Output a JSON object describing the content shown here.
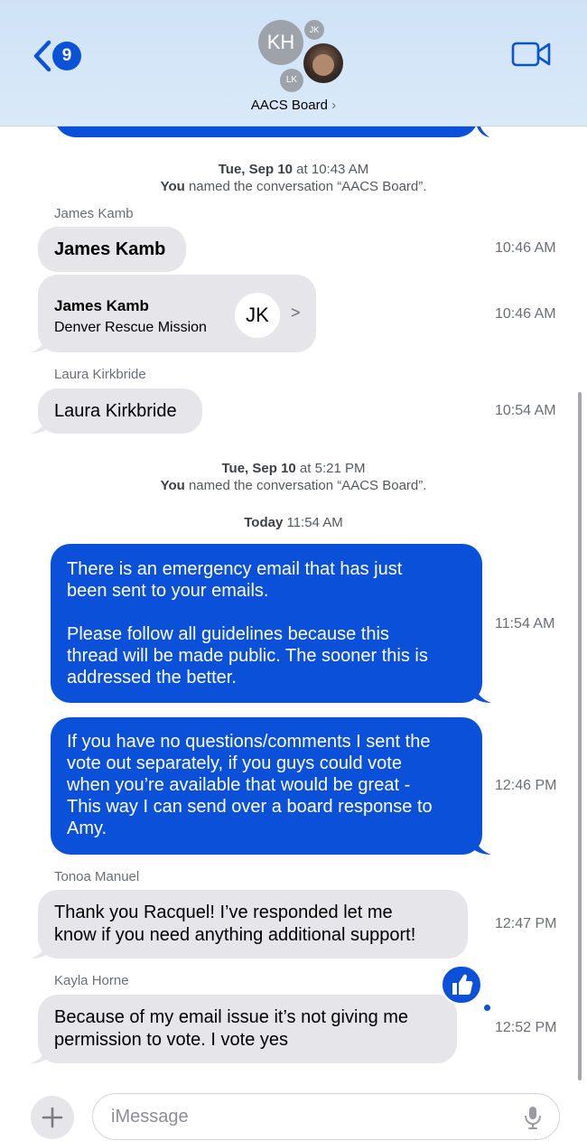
{
  "header": {
    "back_badge": "9",
    "group_name": "AACS Board",
    "avatars": {
      "main": "KH",
      "small_top": "JK",
      "small_bottom": "LK"
    }
  },
  "events": [
    {
      "date": "Tue, Sep 10",
      "time": " at 10:43 AM",
      "actor": "You",
      "action": " named the conversation “AACS Board”."
    },
    {
      "date": "Tue, Sep 10",
      "time": " at 5:21 PM",
      "actor": "You",
      "action": " named the conversation “AACS Board”."
    }
  ],
  "today_label": {
    "day": "Today",
    "time": " 11:54 AM"
  },
  "messages": [
    {
      "sender": "James Kamb",
      "text": "James Kamb",
      "time": "10:46 AM"
    },
    {
      "card_name": "James Kamb",
      "card_org": "Denver Rescue Mission",
      "card_initials": "JK",
      "time": "10:46 AM"
    },
    {
      "sender": "Laura Kirkbride",
      "text": "Laura Kirkbride",
      "time": "10:54 AM"
    },
    {
      "line1": "There is an emergency email that has just",
      "line2": "been sent to your emails.",
      "line3": "Please follow all guidelines because this",
      "line4": "thread will be made public.  The sooner this is",
      "line5": "addressed the better.",
      "time": "11:54 AM"
    },
    {
      "line1": "If you have no questions/comments I sent the",
      "line2": "vote out separately, if you guys could vote",
      "line3": "when you’re available that would be great -",
      "line4": "This way I can send over a board response to",
      "line5": "Amy.",
      "time": "12:46 PM"
    },
    {
      "sender": "Tonoa Manuel",
      "line1": "Thank you Racquel! I’ve responded let me",
      "line2": "know if you need anything additional support!",
      "time": "12:47 PM"
    },
    {
      "sender": "Kayla Horne",
      "line1": "Because of my email issue it’s not giving me",
      "line2": "permission to vote. I vote yes",
      "time": "12:52 PM",
      "reaction": "thumbs-up"
    }
  ],
  "composer": {
    "placeholder": "iMessage"
  },
  "colors": {
    "outgoing": "#0b50d8",
    "incoming": "#e5e5ea",
    "accent": "#0a52d6"
  }
}
